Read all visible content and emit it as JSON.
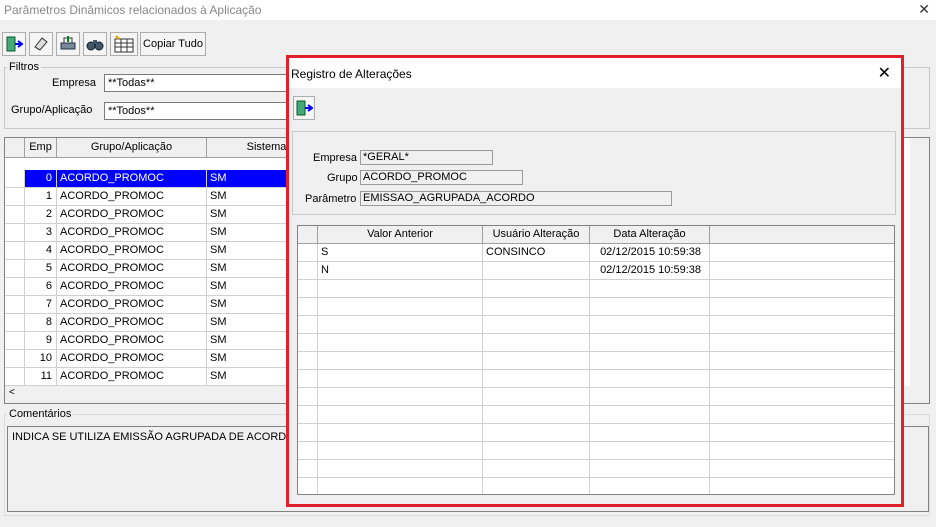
{
  "window": {
    "title": "Parâmetros Dinâmicos relacionados à Aplicação",
    "close": "✕"
  },
  "toolbar": {
    "copy_all_label": "Copiar Tudo"
  },
  "filters": {
    "legend": "Filtros",
    "empresa_label": "Empresa",
    "empresa_value": "**Todas**",
    "grupo_label": "Grupo/Aplicação",
    "grupo_value": "**Todos**"
  },
  "grid": {
    "headers": {
      "emp": "Emp",
      "grupo": "Grupo/Aplicação",
      "sistema": "Sistema"
    },
    "rows": [
      {
        "emp": "0",
        "grupo": "ACORDO_PROMOC",
        "sistema": "SM"
      },
      {
        "emp": "1",
        "grupo": "ACORDO_PROMOC",
        "sistema": "SM"
      },
      {
        "emp": "2",
        "grupo": "ACORDO_PROMOC",
        "sistema": "SM"
      },
      {
        "emp": "3",
        "grupo": "ACORDO_PROMOC",
        "sistema": "SM"
      },
      {
        "emp": "4",
        "grupo": "ACORDO_PROMOC",
        "sistema": "SM"
      },
      {
        "emp": "5",
        "grupo": "ACORDO_PROMOC",
        "sistema": "SM"
      },
      {
        "emp": "6",
        "grupo": "ACORDO_PROMOC",
        "sistema": "SM"
      },
      {
        "emp": "7",
        "grupo": "ACORDO_PROMOC",
        "sistema": "SM"
      },
      {
        "emp": "8",
        "grupo": "ACORDO_PROMOC",
        "sistema": "SM"
      },
      {
        "emp": "9",
        "grupo": "ACORDO_PROMOC",
        "sistema": "SM"
      },
      {
        "emp": "10",
        "grupo": "ACORDO_PROMOC",
        "sistema": "SM"
      },
      {
        "emp": "11",
        "grupo": "ACORDO_PROMOC",
        "sistema": "SM"
      }
    ]
  },
  "comments": {
    "legend": "Comentários",
    "text": "INDICA SE UTILIZA EMISSÃO AGRUPADA DE ACORD"
  },
  "dialog": {
    "title": "Registro de Alterações",
    "close": "✕",
    "empresa_label": "Empresa",
    "empresa_value": "*GERAL*",
    "grupo_label": "Grupo",
    "grupo_value": "ACORDO_PROMOC",
    "parametro_label": "Parâmetro",
    "parametro_value": "EMISSAO_AGRUPADA_ACORDO",
    "headers": {
      "anterior": "Valor Anterior",
      "usuario": "Usuário Alteração",
      "data": "Data Alteração"
    },
    "rows": [
      {
        "anterior": "S",
        "usuario": "CONSINCO",
        "data": "02/12/2015 10:59:38"
      },
      {
        "anterior": "N",
        "usuario": "",
        "data": "02/12/2015 10:59:38"
      }
    ]
  },
  "colors": {
    "selection": "#0000ff",
    "dialog_border": "#e0202a"
  }
}
